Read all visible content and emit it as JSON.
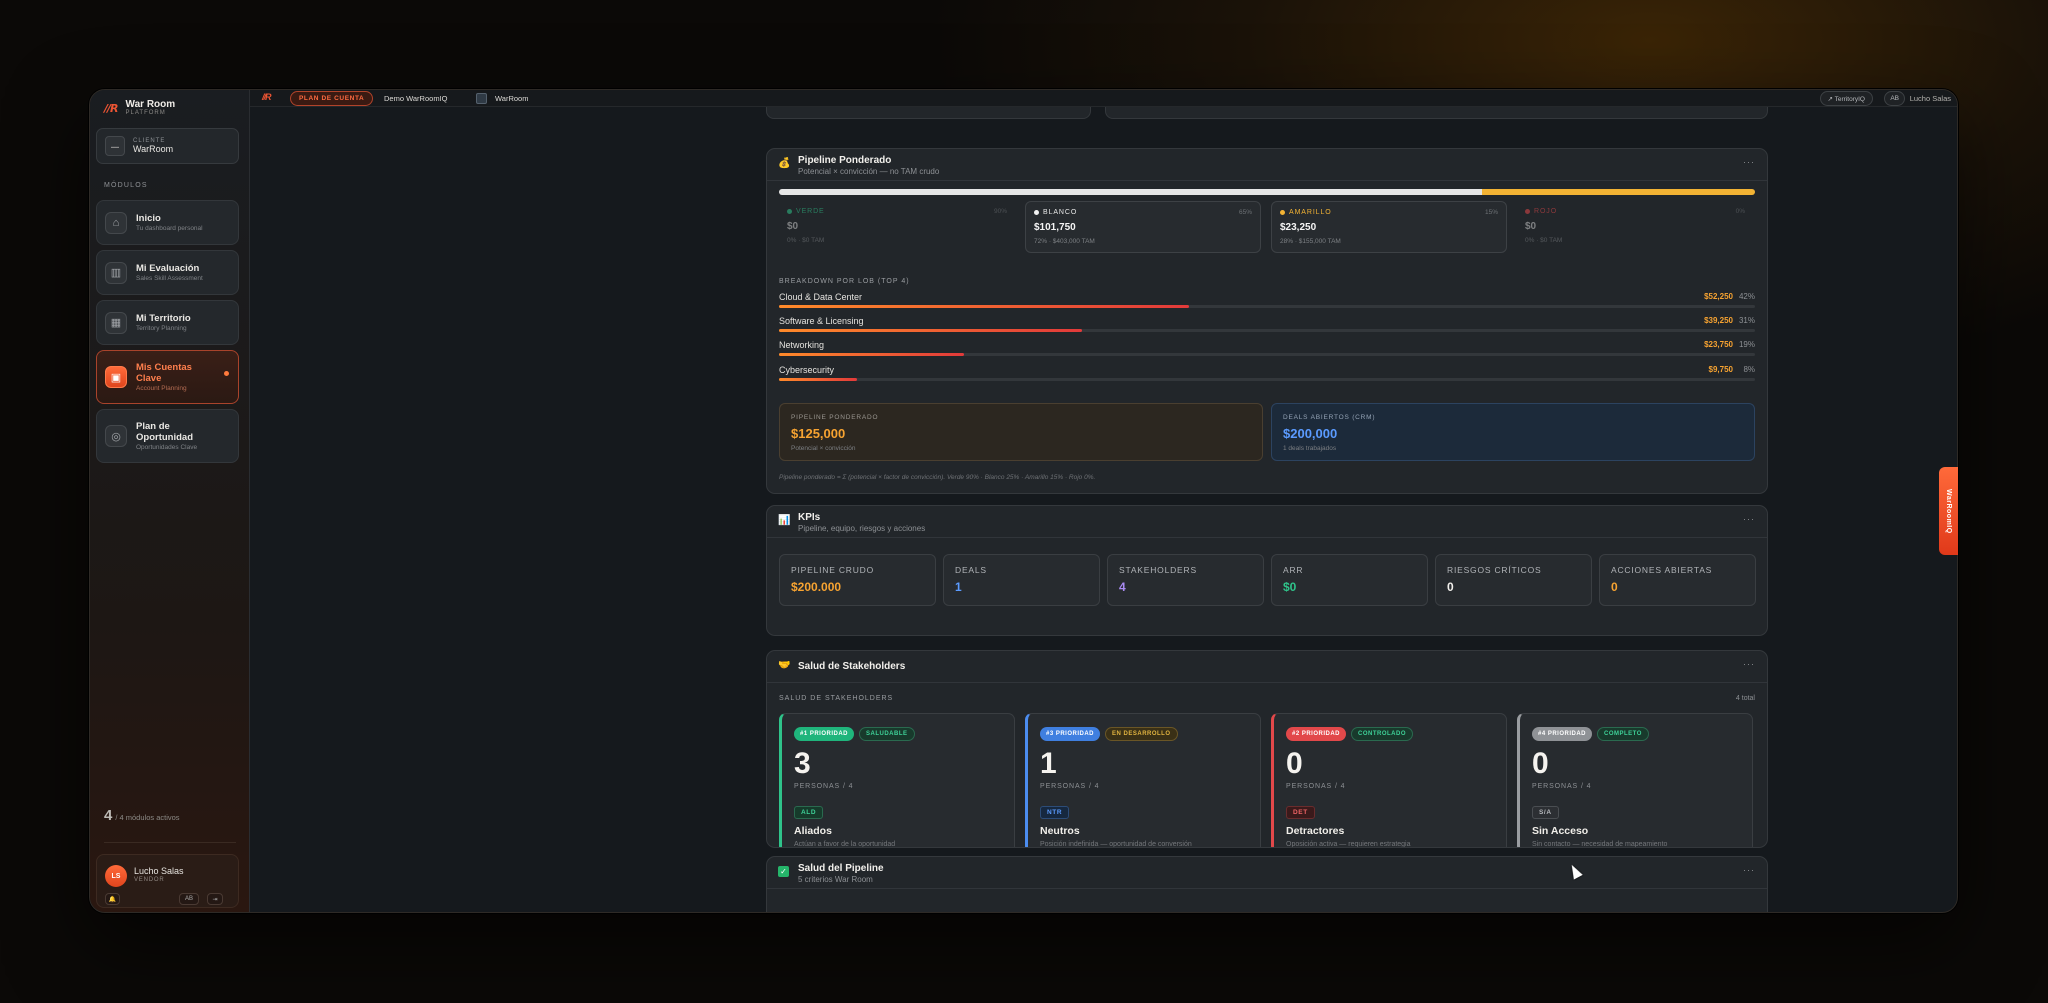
{
  "sidebar": {
    "brand_title": "War Room",
    "brand_sub": "PLATFORM",
    "client_label": "CLIENTE",
    "client_name": "WarRoom",
    "modules_heading": "MÓDULOS",
    "items": [
      {
        "title": "Inicio",
        "sub": "Tu dashboard personal",
        "icon": "home-icon"
      },
      {
        "title": "Mi Evaluación",
        "sub": "Sales Skill Assessment",
        "icon": "bar-chart-icon"
      },
      {
        "title": "Mi Territorio",
        "sub": "Territory Planning",
        "icon": "map-icon"
      },
      {
        "title": "Mis Cuentas Clave",
        "sub": "Account Planning",
        "icon": "briefcase-icon"
      },
      {
        "title": "Plan de Oportunidad",
        "sub": "Oportunidades Clave",
        "icon": "target-icon"
      }
    ],
    "module_count": "4",
    "module_count_text": "/ 4 módulos activos",
    "user_initials": "LS",
    "user_name": "Lucho Salas",
    "user_role": "VENDOR",
    "user_btn_ab": "AB"
  },
  "topbar": {
    "pill": "PLAN DE CUENTA",
    "crumb_1": "Demo WarRoomIQ",
    "crumb_2": "WarRoom",
    "territory": "↗ TerritoryIQ",
    "ab": "AB",
    "user": "Lucho Salas"
  },
  "pipeline": {
    "title": "Pipeline Ponderado",
    "subtitle": "Potencial × convicción — no TAM crudo",
    "progress": {
      "blanco_pct": 72,
      "amarillo_pct": 28
    },
    "tiers": [
      {
        "label": "VERDE",
        "pct": "90%",
        "value": "$0",
        "sub": "0%  ·  $0 TAM",
        "color": "#2fc38a"
      },
      {
        "label": "BLANCO",
        "pct": "65%",
        "value": "$101,750",
        "sub": "72%  ·  $403,000 TAM",
        "color": "#f2f2f2"
      },
      {
        "label": "AMARILLO",
        "pct": "15%",
        "value": "$23,250",
        "sub": "28%  ·  $155,000 TAM",
        "color": "#f3b334"
      },
      {
        "label": "ROJO",
        "pct": "0%",
        "value": "$0",
        "sub": "0%  ·  $0 TAM",
        "color": "#e2484a"
      }
    ],
    "breakdown_label": "BREAKDOWN POR LOB (TOP 4)",
    "lobs": [
      {
        "name": "Cloud & Data Center",
        "value": "$52,250",
        "pct": "42%",
        "share": 42
      },
      {
        "name": "Software & Licensing",
        "value": "$39,250",
        "pct": "31%",
        "share": 31
      },
      {
        "name": "Networking",
        "value": "$23,750",
        "pct": "19%",
        "share": 19
      },
      {
        "name": "Cybersecurity",
        "value": "$9,750",
        "pct": "8%",
        "share": 8
      }
    ],
    "summary_left": {
      "label": "PIPELINE PONDERADO",
      "value": "$125,000",
      "sub": "Potencial × convicción"
    },
    "summary_right": {
      "label": "DEALS ABIERTOS (CRM)",
      "value": "$200,000",
      "sub": "1 deals trabajados"
    },
    "footnote": "Pipeline ponderado = Σ (potencial × factor de convicción). Verde 90% · Blanco 25% · Amarillo 15% · Rojo 0%."
  },
  "kpis": {
    "title": "KPIs",
    "subtitle": "Pipeline, equipo, riesgos y acciones",
    "items": [
      {
        "label": "PIPELINE CRUDO",
        "value": "$200.000",
        "color": "#f7a331"
      },
      {
        "label": "DEALS",
        "value": "1",
        "color": "#5b9bff"
      },
      {
        "label": "STAKEHOLDERS",
        "value": "4",
        "color": "#a98bf2"
      },
      {
        "label": "ARR",
        "value": "$0",
        "color": "#2fc38a"
      },
      {
        "label": "RIESGOS CRÍTICOS",
        "value": "0",
        "color": "#f2f0ec"
      },
      {
        "label": "ACCIONES ABIERTAS",
        "value": "0",
        "color": "#f7a331"
      }
    ]
  },
  "stakeholders": {
    "title": "Salud de Stakeholders",
    "section_label": "SALUD DE STAKEHOLDERS",
    "total": "4 total",
    "cards": [
      {
        "priority": "#1 PRIORIDAD",
        "status": "SALUDABLE",
        "num": "3",
        "sub": "PERSONAS / 4",
        "tag": "ALD",
        "name": "Aliados",
        "desc": "Actúan a favor de la oportunidad",
        "accent": "#2fc38a"
      },
      {
        "priority": "#3 PRIORIDAD",
        "status": "EN DESARROLLO",
        "num": "1",
        "sub": "PERSONAS / 4",
        "tag": "NTR",
        "name": "Neutros",
        "desc": "Posición indefinida — oportunidad de conversión",
        "accent": "#4c8df0"
      },
      {
        "priority": "#2 PRIORIDAD",
        "status": "CONTROLADO",
        "num": "0",
        "sub": "PERSONAS / 4",
        "tag": "DET",
        "name": "Detractores",
        "desc": "Oposición activa — requieren estrategia",
        "accent": "#e2484a"
      },
      {
        "priority": "#4 PRIORIDAD",
        "status": "COMPLETO",
        "num": "0",
        "sub": "PERSONAS / 4",
        "tag": "S/A",
        "name": "Sin Acceso",
        "desc": "Sin contacto — necesidad de mapeamiento",
        "accent": "#9a9da1"
      }
    ]
  },
  "pipeline_health": {
    "title": "Salud del Pipeline",
    "subtitle": "5 criterios War Room"
  },
  "side_tab": "WarRoomIQ"
}
